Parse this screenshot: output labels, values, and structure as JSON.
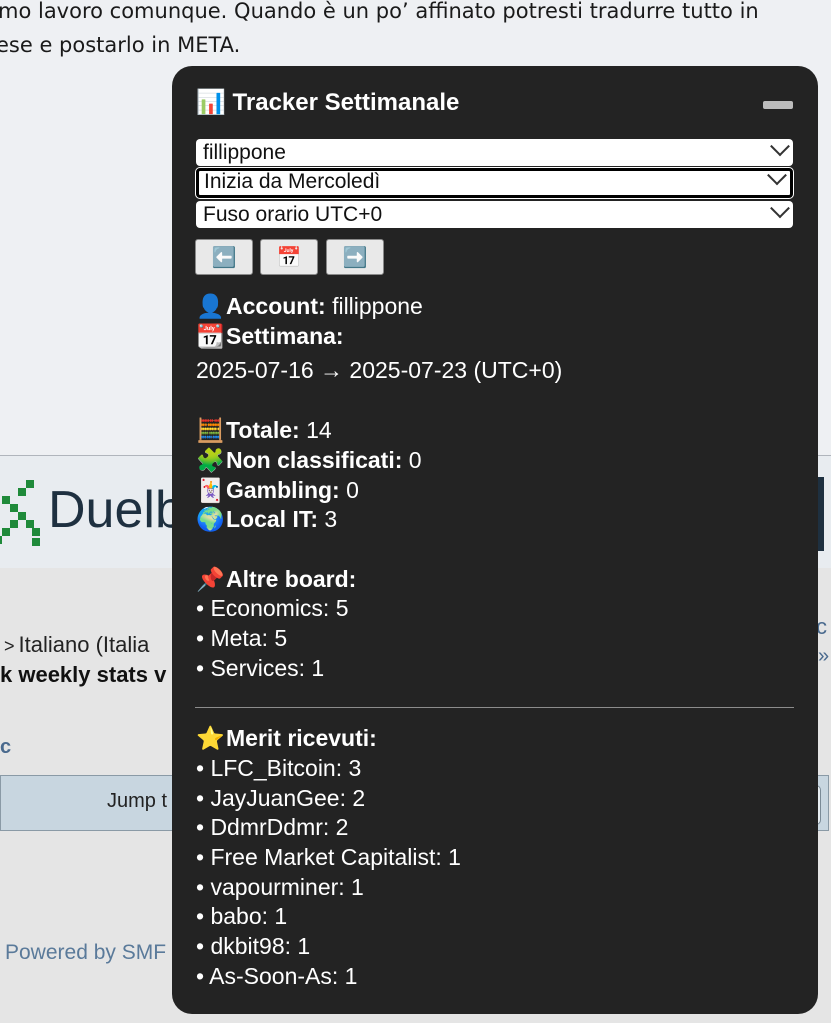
{
  "background": {
    "post_text": [
      "mo lavoro comunque. Quando è un po’ affinato potresti tradurre tutto in",
      "ese e postarlo in META."
    ],
    "banner_text": "Duelb",
    "breadcrumb": "Italiano (Italia",
    "breadcrumb_sep": ">",
    "topic_title": "k weekly stats v",
    "right_c": "c",
    "right_raquo": "»",
    "left_c": "c",
    "jump_label": "Jump t",
    "powered": "Powered by SMF"
  },
  "tracker": {
    "title": "📊 Tracker Settimanale",
    "selects": {
      "account": "fillippone",
      "start_day": "Inizia da Mercoledì",
      "timezone": "Fuso orario UTC+0"
    },
    "nav": {
      "prev": "⬅️",
      "calendar": "📅",
      "next": "➡️"
    },
    "account": {
      "icon": "👤",
      "label": "Account:",
      "value": "fillippone"
    },
    "week": {
      "icon": "📆",
      "label": "Settimana:",
      "range": "2025-07-16 → 2025-07-23 (UTC+0)"
    },
    "stats": [
      {
        "icon": "🧮",
        "label": "Totale:",
        "value": "14"
      },
      {
        "icon": "🧩",
        "label": "Non classificati:",
        "value": "0"
      },
      {
        "icon": "🃏",
        "label": "Gambling:",
        "value": "0"
      },
      {
        "icon": "🌍",
        "label": "Local IT:",
        "value": "3"
      }
    ],
    "other_boards": {
      "icon": "📌",
      "label": "Altre board:",
      "items": [
        "• Economics: 5",
        "• Meta: 5",
        "• Services: 1"
      ]
    },
    "merit": {
      "icon": "⭐",
      "label": "Merit ricevuti:",
      "items": [
        "• LFC_Bitcoin: 3",
        "• JayJuanGee: 2",
        "• DdmrDdmr: 2",
        "• Free Market Capitalist: 1",
        "• vapourminer: 1",
        "• babo: 1",
        "• dkbit98: 1",
        "• As-Soon-As: 1"
      ]
    }
  }
}
